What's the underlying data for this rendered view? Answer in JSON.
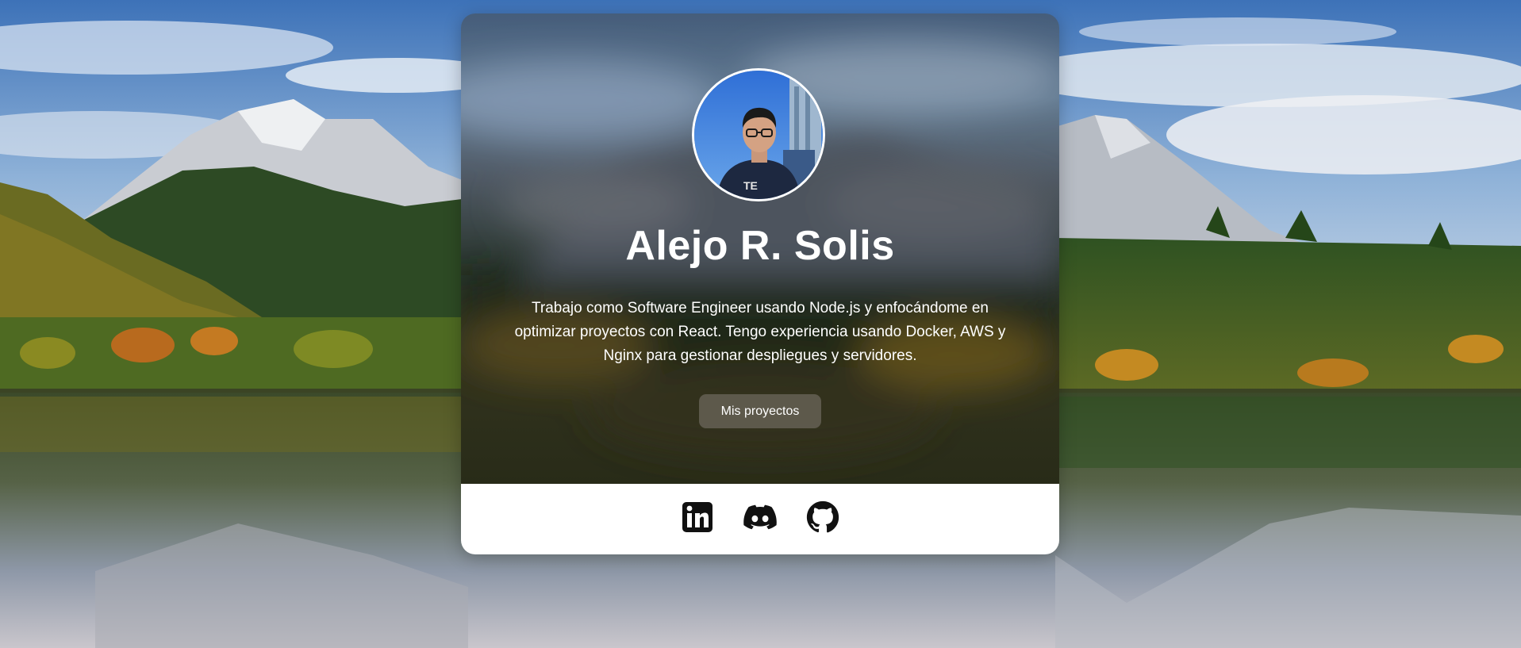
{
  "profile": {
    "name": "Alejo R. Solis",
    "bio": "Trabajo como Software Engineer usando Node.js y enfocándome en optimizar proyectos con React. Tengo experiencia usando Docker, AWS y Nginx para gestionar despliegues y servidores.",
    "projects_button_label": "Mis proyectos"
  },
  "socials": [
    {
      "name": "linkedin",
      "icon": "linkedin-icon"
    },
    {
      "name": "discord",
      "icon": "discord-icon"
    },
    {
      "name": "github",
      "icon": "github-icon"
    }
  ],
  "colors": {
    "card_footer": "#ffffff",
    "icon": "#111111",
    "button_bg": "#7a7369",
    "text": "#ffffff"
  }
}
